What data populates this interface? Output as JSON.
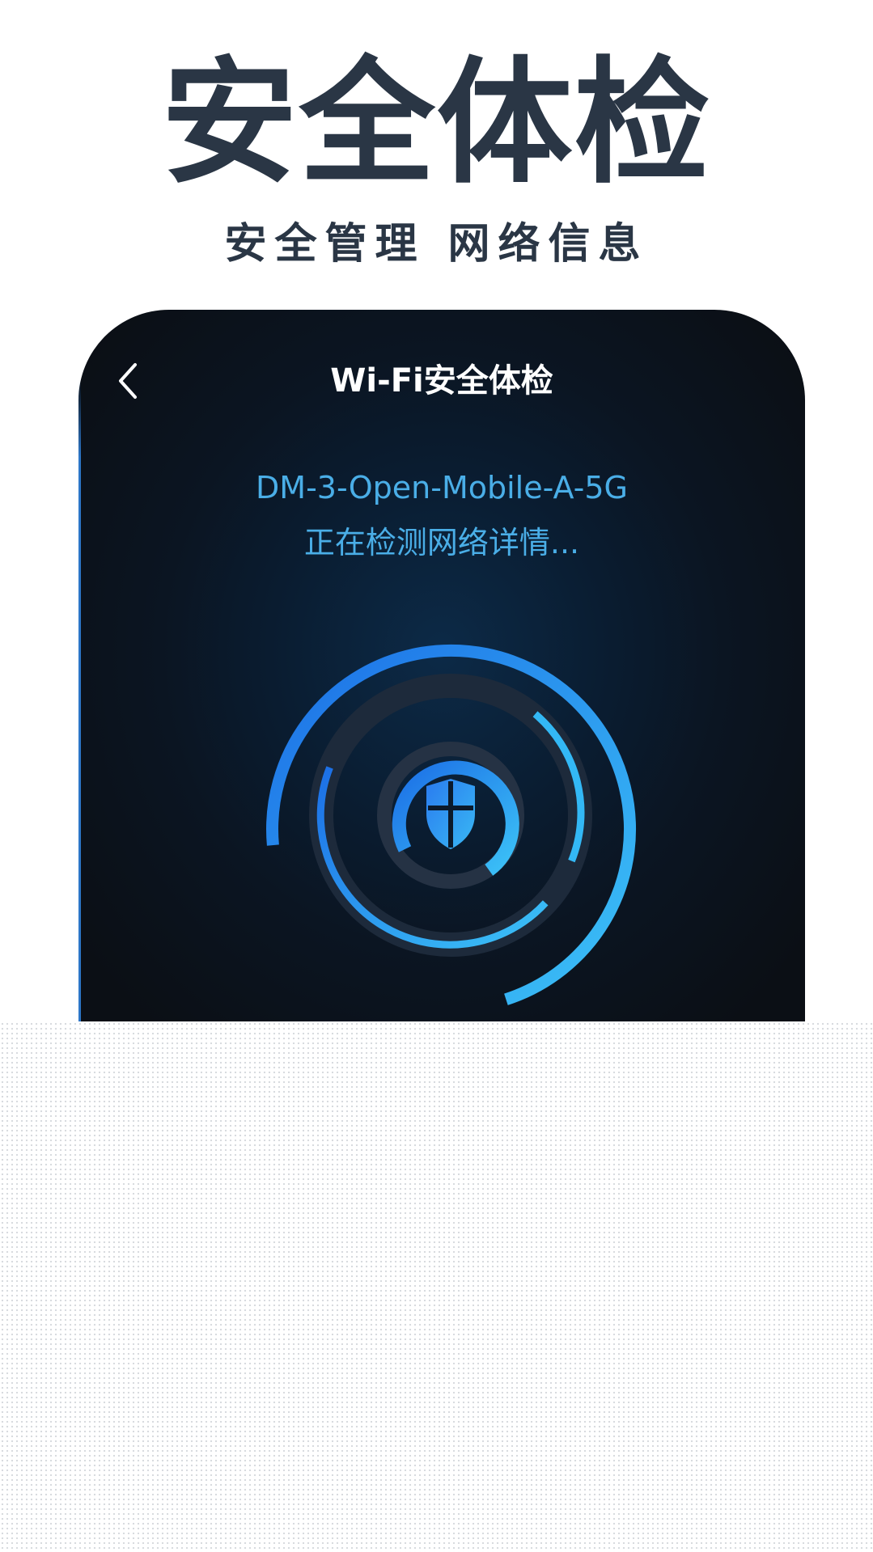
{
  "promo": {
    "headline": "安全体检",
    "subheadline": "安全管理 网络信息"
  },
  "screen": {
    "nav": {
      "back_icon": "chevron-left-icon",
      "title": "Wi-Fi安全体检"
    },
    "network_name": "DM-3-Open-Mobile-A-5G",
    "status_text": "正在检测网络详情...",
    "scanner": {
      "center_icon": "shield-icon"
    }
  },
  "colors": {
    "headline": "#2a3645",
    "accent_blue": "#4aaee7",
    "ring_start": "#1c74e9",
    "ring_end": "#39bdf5",
    "screen_bg": "#0b1522"
  }
}
